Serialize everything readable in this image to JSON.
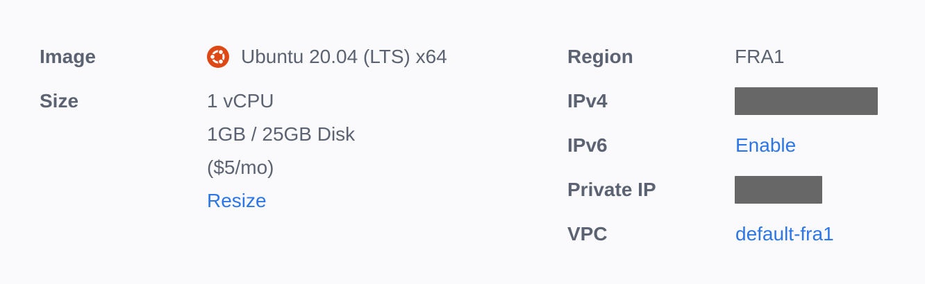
{
  "left": {
    "image_label": "Image",
    "image_value": "Ubuntu 20.04 (LTS) x64",
    "image_icon": "ubuntu-icon",
    "size_label": "Size",
    "size_lines": [
      "1 vCPU",
      "1GB / 25GB Disk",
      "($5/mo)"
    ],
    "resize_link": "Resize"
  },
  "right": {
    "region_label": "Region",
    "region_value": "FRA1",
    "ipv4_label": "IPv4",
    "ipv6_label": "IPv6",
    "ipv6_link": "Enable",
    "private_ip_label": "Private IP",
    "vpc_label": "VPC",
    "vpc_link": "default-fra1"
  },
  "colors": {
    "label": "#5b6271",
    "link": "#2c76e6",
    "redaction": "#676768",
    "ubuntu": "#dd4814"
  }
}
